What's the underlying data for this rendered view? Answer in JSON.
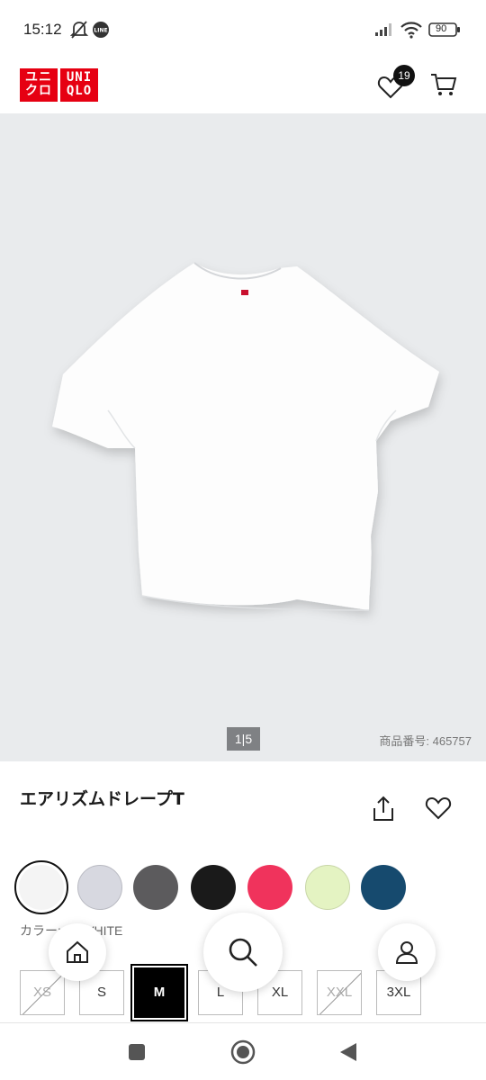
{
  "status": {
    "time": "15:12",
    "battery": "90",
    "icons": [
      "bell-off-icon",
      "line-app-icon",
      "signal-icon",
      "wifi-icon",
      "battery-icon"
    ]
  },
  "header": {
    "logo_top": "ユニクロ",
    "logo_bottom": "UNIQLO",
    "logo_top_line1": "ユニ",
    "logo_top_line2": "クロ",
    "logo_bottom_line1": "UNI",
    "logo_bottom_line2": "QLO",
    "wishlist_count": "19",
    "brand_color": "#e60012"
  },
  "gallery": {
    "pager": "1|5",
    "product_number": "商品番号: 465757",
    "background_color": "#e9ebed"
  },
  "product": {
    "title": "エアリズムドレープT",
    "color_label": "カラー: 00 WHITE",
    "colors": [
      {
        "name": "WHITE",
        "hex": "#f4f4f4",
        "selected": true
      },
      {
        "name": "LIGHT GRAY",
        "hex": "#d7d8e0"
      },
      {
        "name": "DARK GRAY",
        "hex": "#5c5b5d"
      },
      {
        "name": "BLACK",
        "hex": "#1a1a1a"
      },
      {
        "name": "PINK",
        "hex": "#f0335c"
      },
      {
        "name": "LIGHT GREEN",
        "hex": "#e4f3c2"
      },
      {
        "name": "BLUE",
        "hex": "#164a6e"
      }
    ],
    "sizes": [
      {
        "label": "XS",
        "state": "disabled"
      },
      {
        "label": "S",
        "state": "available"
      },
      {
        "label": "M",
        "state": "selected"
      },
      {
        "label": "L",
        "state": "available"
      },
      {
        "label": "XL",
        "state": "available"
      },
      {
        "label": "XXL",
        "state": "disabled"
      },
      {
        "label": "3XL",
        "state": "available"
      }
    ]
  },
  "floating_nav": [
    "home-icon",
    "search-icon",
    "account-icon"
  ],
  "system_nav": [
    "recents-icon",
    "home-circle-icon",
    "back-icon"
  ]
}
